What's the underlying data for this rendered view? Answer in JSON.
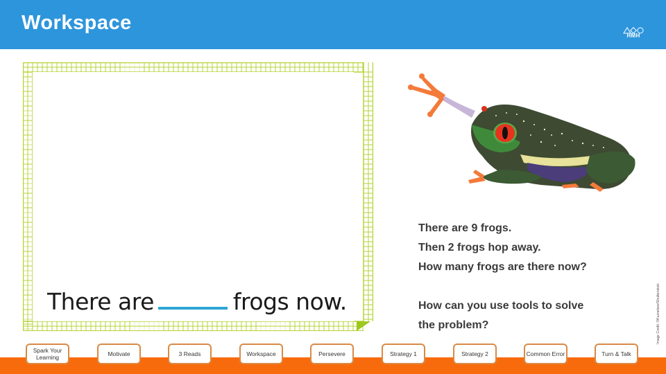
{
  "header": {
    "title": "Workspace",
    "logo_text": "HMH",
    "logo_shapes": "△◇○",
    "color": "#2d95dc"
  },
  "worksheet": {
    "sentence_start": "There are",
    "sentence_end": "frogs now.",
    "answer_value": ""
  },
  "image": {
    "subject": "red-eyed tree frog",
    "credit": "Image Credit: ©Kuznetsov/Shutterstock"
  },
  "problem": {
    "lines": [
      "There are 9 frogs.",
      "Then 2 frogs hop away.",
      "How many frogs are there now?"
    ],
    "question_lines": [
      "How can you use tools to solve",
      "the problem?"
    ]
  },
  "nav": {
    "accent": "#f76b0c",
    "buttons": [
      "Spark Your Learning",
      "Motivate",
      "3 Reads",
      "Workspace",
      "Persevere",
      "Strategy 1",
      "Strategy 2",
      "Common Error",
      "Turn & Talk"
    ]
  }
}
